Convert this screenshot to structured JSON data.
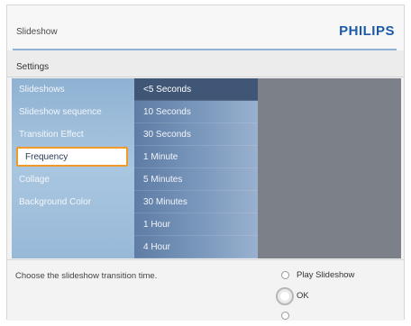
{
  "header": {
    "title": "Slideshow",
    "brand": "PHILIPS",
    "accent_color": "#1c5aa8"
  },
  "section": {
    "title": "Settings"
  },
  "menu": {
    "items": [
      {
        "label": "Slideshows",
        "selected": false
      },
      {
        "label": "Slideshow sequence",
        "selected": false
      },
      {
        "label": "Transition Effect",
        "selected": false
      },
      {
        "label": "Frequency",
        "selected": true
      },
      {
        "label": "Collage",
        "selected": false
      },
      {
        "label": "Background Color",
        "selected": false
      }
    ]
  },
  "options": {
    "items": [
      {
        "label": "<5 Seconds",
        "current": true
      },
      {
        "label": "10 Seconds",
        "current": false
      },
      {
        "label": "30 Seconds",
        "current": false
      },
      {
        "label": "1 Minute",
        "current": false
      },
      {
        "label": "5 Minutes",
        "current": false
      },
      {
        "label": "30 Minutes",
        "current": false
      },
      {
        "label": "1 Hour",
        "current": false
      },
      {
        "label": "4 Hour",
        "current": false
      }
    ]
  },
  "footer": {
    "hint": "Choose the slideshow transition time.",
    "controls": {
      "play_label": "Play Slideshow",
      "ok_label": "OK"
    },
    "selection_color": "#f09a2a"
  }
}
